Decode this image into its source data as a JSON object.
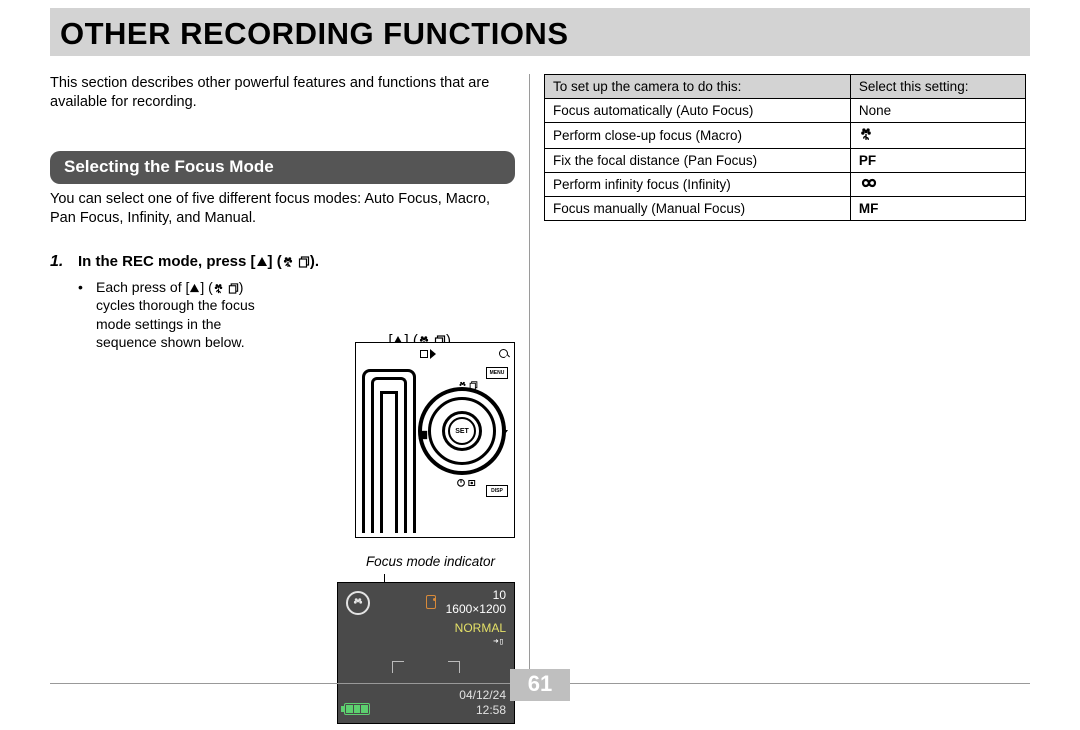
{
  "title": "OTHER RECORDING FUNCTIONS",
  "intro": "This section describes other powerful features and functions that are available for recording.",
  "section_header": "Selecting the Focus Mode",
  "section_body": "You can select one of five different focus modes: Auto Focus, Macro, Pan Focus, Infinity, and Manual.",
  "step_num": "1.",
  "step_title_a": "In the REC mode, press [",
  "step_title_b": "] (",
  "step_title_c": ").",
  "up_label_a": "[",
  "up_label_b": "] (",
  "up_label_c": ")",
  "bullet_a": "Each press of [",
  "bullet_b": "] (",
  "bullet_c": ") cycles thorough the focus mode settings in the sequence shown below.",
  "cb_menu": "MENU",
  "cb_set": "SET",
  "cb_disp": "DISP",
  "fmi_label": "Focus mode indicator",
  "lcd": {
    "shots": "10",
    "res": "1600×1200",
    "normal": "NORMAL",
    "date": "04/12/24",
    "time": "12:58"
  },
  "table": {
    "head_do": "To set up the camera to do this:",
    "head_set": "Select this setting:",
    "rows": [
      {
        "do": "Focus automatically (Auto Focus)",
        "set": "None",
        "icon": ""
      },
      {
        "do": "Perform close-up focus (Macro)",
        "set": "",
        "icon": "flower"
      },
      {
        "do": "Fix the focal distance (Pan Focus)",
        "set": "PF",
        "icon": ""
      },
      {
        "do": "Perform infinity focus (Infinity)",
        "set": "",
        "icon": "infinity"
      },
      {
        "do": "Focus manually (Manual Focus)",
        "set": "MF",
        "icon": ""
      }
    ]
  },
  "page_num": "61"
}
